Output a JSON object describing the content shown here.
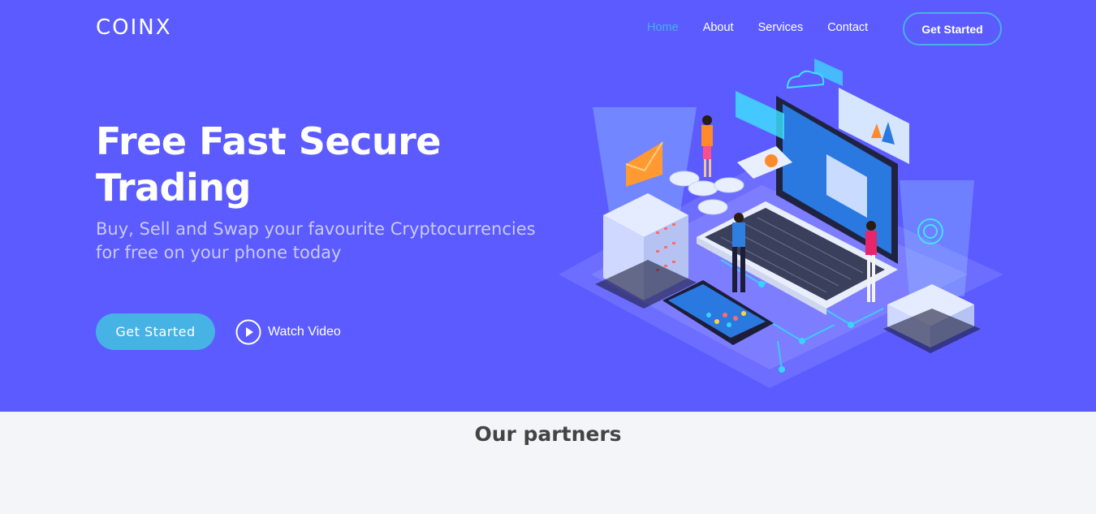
{
  "brand": {
    "logo": "COINX"
  },
  "nav": {
    "items": [
      {
        "label": "Home",
        "active": true
      },
      {
        "label": "About",
        "active": false
      },
      {
        "label": "Services",
        "active": false
      },
      {
        "label": "Contact",
        "active": false
      }
    ],
    "cta_label": "Get Started"
  },
  "hero": {
    "title_line1": "Free Fast Secure",
    "title_line2": "Trading",
    "subtitle_line1": "Buy, Sell and Swap your favourite Cryptocurrencies",
    "subtitle_line2": "for free on your phone today",
    "cta_label": "Get Started",
    "video_label": "Watch Video",
    "video_icon": "play-circle-icon"
  },
  "partners": {
    "title": "Our partners"
  },
  "colors": {
    "hero_bg": "#5b5bff",
    "accent": "#47b2e4",
    "page_bg": "#f4f5f9"
  }
}
